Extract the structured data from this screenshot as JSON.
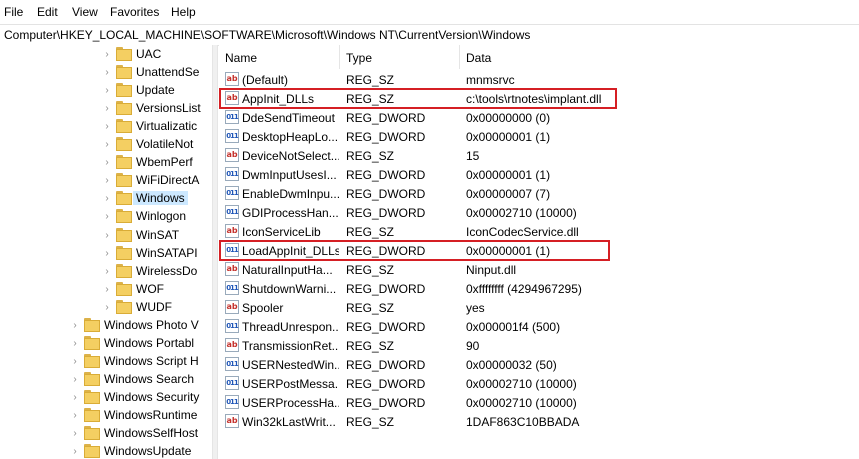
{
  "menu": [
    "File",
    "Edit",
    "View",
    "Favorites",
    "Help"
  ],
  "address": "Computer\\HKEY_LOCAL_MACHINE\\SOFTWARE\\Microsoft\\Windows NT\\CurrentVersion\\Windows",
  "tree": {
    "items": [
      {
        "label": "UAC",
        "level": 2
      },
      {
        "label": "UnattendSe",
        "level": 2
      },
      {
        "label": "Update",
        "level": 2
      },
      {
        "label": "VersionsList",
        "level": 2
      },
      {
        "label": "Virtualizatic",
        "level": 2
      },
      {
        "label": "VolatileNot",
        "level": 2
      },
      {
        "label": "WbemPerf",
        "level": 2
      },
      {
        "label": "WiFiDirectA",
        "level": 2
      },
      {
        "label": "Windows",
        "level": 2,
        "selected": true
      },
      {
        "label": "Winlogon",
        "level": 2
      },
      {
        "label": "WinSAT",
        "level": 2
      },
      {
        "label": "WinSATAPI",
        "level": 2
      },
      {
        "label": "WirelessDo",
        "level": 2
      },
      {
        "label": "WOF",
        "level": 2
      },
      {
        "label": "WUDF",
        "level": 2
      },
      {
        "label": "Windows Photo V",
        "level": 1
      },
      {
        "label": "Windows Portabl",
        "level": 1
      },
      {
        "label": "Windows Script H",
        "level": 1
      },
      {
        "label": "Windows Search",
        "level": 1
      },
      {
        "label": "Windows Security",
        "level": 1
      },
      {
        "label": "WindowsRuntime",
        "level": 1
      },
      {
        "label": "WindowsSelfHost",
        "level": 1
      },
      {
        "label": "WindowsUpdate",
        "level": 1
      }
    ]
  },
  "columns": {
    "name": "Name",
    "type": "Type",
    "data": "Data"
  },
  "values": [
    {
      "name": "(Default)",
      "type": "REG_SZ",
      "data": "mnmsrvc",
      "icon": "string-value-icon"
    },
    {
      "name": "AppInit_DLLs",
      "type": "REG_SZ",
      "data": "c:\\tools\\rtnotes\\implant.dll",
      "icon": "string-value-icon",
      "highlighted": true
    },
    {
      "name": "DdeSendTimeout",
      "type": "REG_DWORD",
      "data": "0x00000000 (0)",
      "icon": "binary-value-icon"
    },
    {
      "name": "DesktopHeapLo...",
      "type": "REG_DWORD",
      "data": "0x00000001 (1)",
      "icon": "binary-value-icon"
    },
    {
      "name": "DeviceNotSelect...",
      "type": "REG_SZ",
      "data": "15",
      "icon": "string-value-icon"
    },
    {
      "name": "DwmInputUsesI...",
      "type": "REG_DWORD",
      "data": "0x00000001 (1)",
      "icon": "binary-value-icon"
    },
    {
      "name": "EnableDwmInpu...",
      "type": "REG_DWORD",
      "data": "0x00000007 (7)",
      "icon": "binary-value-icon"
    },
    {
      "name": "GDIProcessHan...",
      "type": "REG_DWORD",
      "data": "0x00002710 (10000)",
      "icon": "binary-value-icon"
    },
    {
      "name": "IconServiceLib",
      "type": "REG_SZ",
      "data": "IconCodecService.dll",
      "icon": "string-value-icon"
    },
    {
      "name": "LoadAppInit_DLLs",
      "type": "REG_DWORD",
      "data": "0x00000001 (1)",
      "icon": "binary-value-icon",
      "highlighted": true
    },
    {
      "name": "NaturalInputHa...",
      "type": "REG_SZ",
      "data": "Ninput.dll",
      "icon": "string-value-icon"
    },
    {
      "name": "ShutdownWarni...",
      "type": "REG_DWORD",
      "data": "0xffffffff (4294967295)",
      "icon": "binary-value-icon"
    },
    {
      "name": "Spooler",
      "type": "REG_SZ",
      "data": "yes",
      "icon": "string-value-icon"
    },
    {
      "name": "ThreadUnrespon...",
      "type": "REG_DWORD",
      "data": "0x000001f4 (500)",
      "icon": "binary-value-icon"
    },
    {
      "name": "TransmissionRet...",
      "type": "REG_SZ",
      "data": "90",
      "icon": "string-value-icon"
    },
    {
      "name": "USERNestedWin...",
      "type": "REG_DWORD",
      "data": "0x00000032 (50)",
      "icon": "binary-value-icon"
    },
    {
      "name": "USERPostMessa...",
      "type": "REG_DWORD",
      "data": "0x00002710 (10000)",
      "icon": "binary-value-icon"
    },
    {
      "name": "USERProcessHa...",
      "type": "REG_DWORD",
      "data": "0x00002710 (10000)",
      "icon": "binary-value-icon"
    },
    {
      "name": "Win32kLastWrit...",
      "type": "REG_SZ",
      "data": "1DAF863C10BBADA",
      "icon": "string-value-icon"
    }
  ],
  "colors": {
    "highlight": "#d51f24",
    "selection": "#cce8ff",
    "folder": "#f4cf62"
  }
}
